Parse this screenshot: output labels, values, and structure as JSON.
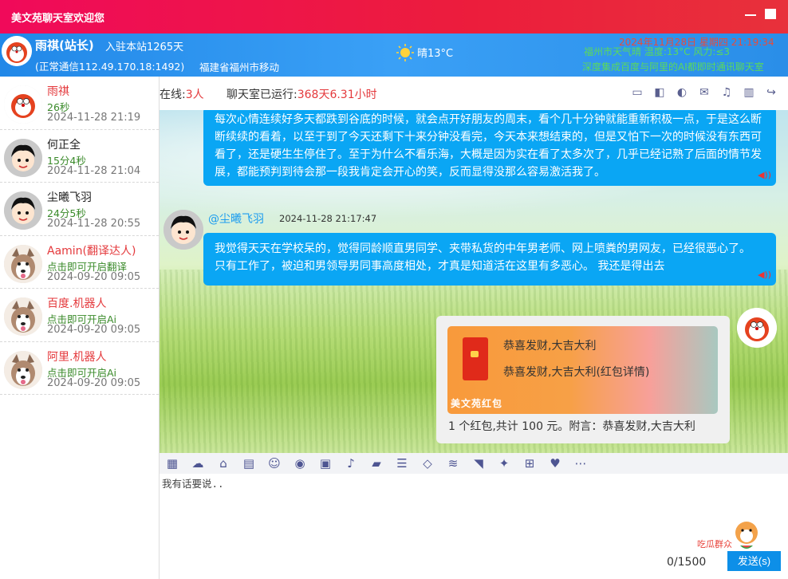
{
  "window": {
    "title": "美文苑聊天室欢迎您"
  },
  "user": {
    "name": "雨祺(站长)",
    "days": "入驻本站1265天",
    "connection": "(正常通信112.49.170.18:1492)",
    "location": "福建省福州市移动"
  },
  "weather": {
    "text": "晴13°C"
  },
  "marquee": {
    "line1": "2024年11月28日 星期四 21:19:34",
    "line2": "福州市天气晴 温度:13°C 风力:≤3",
    "line3": "深度集成百度与阿里的AI都即时通讯聊天室"
  },
  "sidebar": {
    "users": [
      {
        "name": "雨祺",
        "status": "26秒",
        "time": "2024-11-28 21:19",
        "name_color": "#e4393c"
      },
      {
        "name": "何正全",
        "status": "15分4秒",
        "time": "2024-11-28 21:04",
        "name_color": "#222222"
      },
      {
        "name": "尘曦飞羽",
        "status": "24分5秒",
        "time": "2024-11-28 20:55",
        "name_color": "#222222"
      },
      {
        "name": "Aamin(翻译达人)",
        "status": "点击即可开启翻译",
        "time": "2024-09-20 09:05",
        "name_color": "#e4393c"
      },
      {
        "name": "百度.机器人",
        "status": "点击即可开启Ai",
        "time": "2024-09-20 09:05",
        "name_color": "#e4393c"
      },
      {
        "name": "阿里.机器人",
        "status": "点击即可开启Ai",
        "time": "2024-09-20 09:05",
        "name_color": "#e4393c"
      }
    ]
  },
  "chat_header": {
    "online_label": "在线:",
    "online_count": "3人",
    "runtime_label": "聊天室已运行:",
    "runtime_value": "368天6.31小时",
    "icons": [
      "monitor-icon",
      "window-icon",
      "toggle-icon",
      "mail-icon",
      "bell-icon",
      "trash-icon",
      "share-icon"
    ]
  },
  "messages": [
    {
      "text": "每次心情连续好多天都跌到谷底的时候，就会点开好朋友的周末，看个几十分钟就能重新积极一点，于是这么断断续续的看着，以至于到了今天还剩下十来分钟没看完，今天本来想结束的，但是又怕下一次的时候没有东西可看了，还是硬生生停住了。至于为什么不看乐海，大概是因为实在看了太多次了，几乎已经记熟了后面的情节发展，都能预判到待会那一段我肯定会开心的笑，反而显得没那么容易激活我了。"
    },
    {
      "sender": "@尘曦飞羽",
      "time": "2024-11-28 21:17:47",
      "text": "我觉得天天在学校呆的，觉得同龄顺直男同学、夹带私货的中年男老师、网上喷粪的男网友，已经很恶心了。 只有工作了，被迫和男领导男同事高度相处，才真是知道活在这里有多恶心。 我还是得出去"
    }
  ],
  "red_packet": {
    "line1": "恭喜发财,大吉大利",
    "line2": "恭喜发财,大吉大利(红包详情)",
    "brand": "美文苑红包",
    "footer": "1 个红包,共计 100 元。附言：恭喜发财,大吉大利"
  },
  "toolbar": {
    "icons": [
      "grid-icon",
      "cloud-icon",
      "bank-icon",
      "id-card-icon",
      "smile-icon",
      "user-circle-icon",
      "camera-icon",
      "music-icon",
      "folder-icon",
      "server-icon",
      "diamond-icon",
      "database-icon",
      "rss-icon",
      "twitter-icon",
      "windows-icon",
      "heart-icon",
      "more-icon"
    ]
  },
  "input": {
    "placeholder": "我有话要说..",
    "count": "0/1500",
    "send_label": "发送(s)",
    "sticker_text": "吃瓜群众"
  }
}
